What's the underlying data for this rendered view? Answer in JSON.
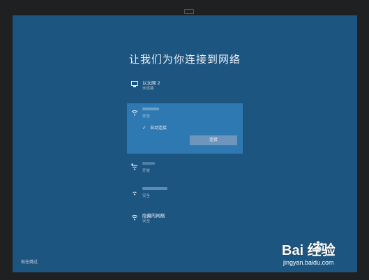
{
  "title": "让我们为你连接到网络",
  "networks": [
    {
      "name": "以太网 2",
      "status": "未连接",
      "type": "ethernet"
    },
    {
      "name": "",
      "status": "安全",
      "type": "wifi",
      "selected": true,
      "auto_connect_label": "自动连接",
      "auto_connect_checked": true,
      "connect_label": "连接"
    },
    {
      "name": "",
      "status": "开放",
      "type": "wifi-open"
    },
    {
      "name": "",
      "status": "安全",
      "type": "wifi"
    },
    {
      "name": "隐藏的网络",
      "status": "安全",
      "type": "wifi"
    }
  ],
  "skip_label": "现在跳过",
  "watermark": {
    "brand": "Bai 经验",
    "url": "jingyan.baidu.com"
  },
  "colors": {
    "background": "#1d5581",
    "selected": "#2f79b3",
    "button": "#6e95bb"
  }
}
